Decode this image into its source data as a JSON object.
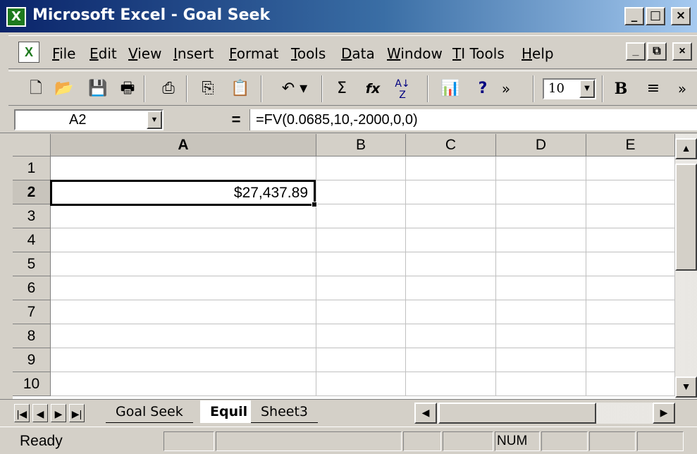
{
  "window": {
    "title": "Microsoft Excel - Goal Seek",
    "app_icon": "X"
  },
  "window_controls": {
    "minimize": "_",
    "restore": "□",
    "close": "×"
  },
  "doc_controls": {
    "minimize": "_",
    "restore": "⧉",
    "close": "×"
  },
  "menu": [
    "File",
    "Edit",
    "View",
    "Insert",
    "Format",
    "Tools",
    "Data",
    "Window",
    "TI Tools",
    "Help"
  ],
  "toolbar": {
    "new": "🗋",
    "open": "📂",
    "save": "💾",
    "print_preview": "🖶",
    "print": "⎙",
    "copy": "⎘",
    "paste": "📋",
    "undo": "↶ ▾",
    "autosum": "Σ",
    "function": "fx",
    "sort": "A↓Z",
    "chart": "📊",
    "help": "?",
    "more": "»",
    "font_size": "10",
    "bold": "B",
    "align": "≡",
    "more2": "»"
  },
  "formula_bar": {
    "name_box": "A2",
    "equals": "=",
    "formula": "=FV(0.0685,10,-2000,0,0)"
  },
  "columns": [
    "A",
    "B",
    "C",
    "D",
    "E"
  ],
  "rows": [
    "1",
    "2",
    "3",
    "4",
    "5",
    "6",
    "7",
    "8",
    "9",
    "10"
  ],
  "selected_cell": {
    "ref": "A2",
    "value": "$27,437.89"
  },
  "sheet_tabs": [
    {
      "name": "Goal Seek",
      "active": false
    },
    {
      "name": "Equil",
      "active": true
    },
    {
      "name": "Sheet3",
      "active": false
    }
  ],
  "nav_buttons": [
    "|◀",
    "◀",
    "▶",
    "▶|"
  ],
  "scroll": {
    "up": "▲",
    "down": "▼",
    "left": "◀",
    "right": "▶"
  },
  "status": {
    "text": "Ready",
    "num": "NUM"
  }
}
